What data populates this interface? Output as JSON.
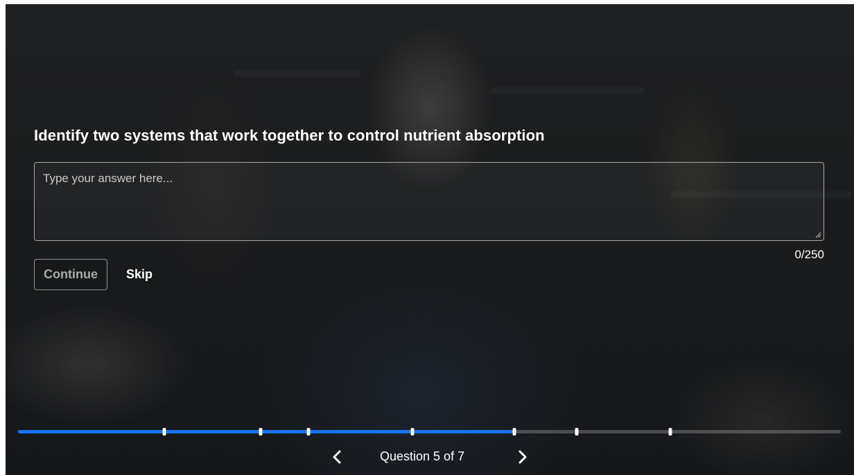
{
  "question": {
    "text": "Identify two systems that work together to control nutrient absorption"
  },
  "answer": {
    "placeholder": "Type your answer here...",
    "value": "",
    "char_count": "0/250"
  },
  "actions": {
    "continue_label": "Continue",
    "skip_label": "Skip"
  },
  "progress": {
    "filled_fraction": 0.605,
    "marker_fractions": [
      0.178,
      0.295,
      0.353,
      0.479,
      0.603,
      0.679,
      0.793
    ],
    "accent_color": "#1672f3",
    "track_color": "#5a5a5a"
  },
  "navigation": {
    "prev_icon": "chevron-left-icon",
    "next_icon": "chevron-right-icon",
    "label": "Question 5 of 7"
  }
}
